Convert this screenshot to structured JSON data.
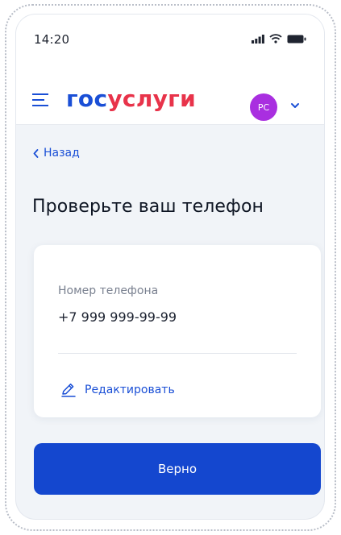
{
  "status_bar": {
    "time": "14:20"
  },
  "header": {
    "logo_part1": "гос",
    "logo_part2": "услуги",
    "avatar_initials": "PC",
    "brand_blue": "#1a4fd6",
    "brand_red": "#e8334a",
    "avatar_color": "#a92fe0"
  },
  "nav": {
    "back_label": "Назад"
  },
  "page": {
    "title": "Проверьте ваш телефон"
  },
  "card": {
    "field_label": "Номер телефона",
    "field_value": "+7 999 999-99-99",
    "edit_label": "Редактировать"
  },
  "actions": {
    "confirm_label": "Верно"
  }
}
